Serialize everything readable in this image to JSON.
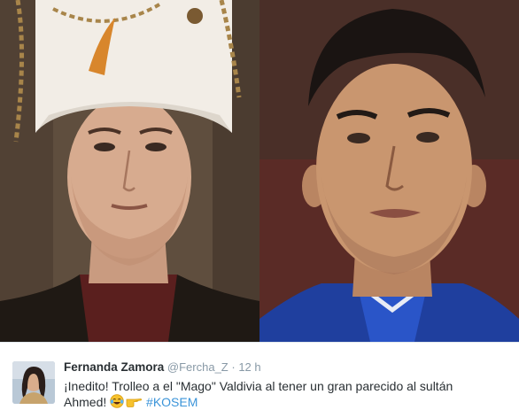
{
  "tweet": {
    "author_name": "Fernanda Zamora",
    "handle": "@Fercha_Z",
    "separator": "·",
    "timestamp": "12 h",
    "text_line1": "¡Inedito! Trolleo a el \"Mago\" Valdivia al tener un gran parecido al sultán",
    "text_line2_before": "Ahmed! ",
    "hashtag": "#KOSEM"
  },
  "icons": {
    "emoji_1": "laughing-tears-emoji",
    "emoji_2": "pointing-hand-emoji"
  },
  "colors": {
    "author_text": "#292f33",
    "meta_text": "#8899a6",
    "hashtag": "#3b94d9",
    "divider": "#e1e8ed"
  }
}
